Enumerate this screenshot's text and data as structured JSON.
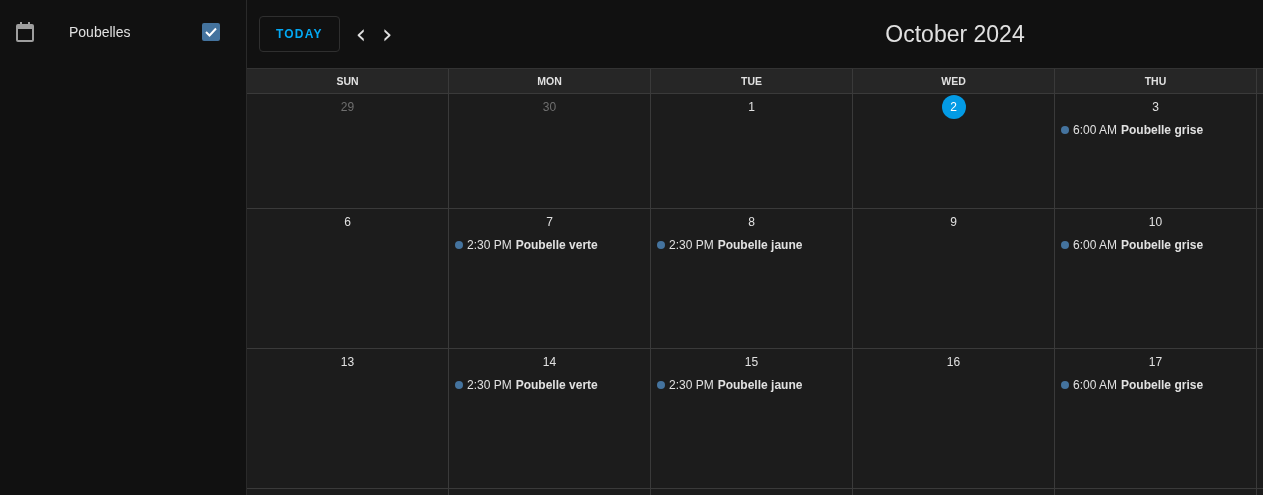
{
  "sidebar": {
    "calendars": [
      {
        "label": "Poubelles",
        "checked": true
      }
    ]
  },
  "toolbar": {
    "today_label": "TODAY",
    "prev": "‹",
    "next": "›",
    "title": "October 2024"
  },
  "weekdays": [
    "SUN",
    "MON",
    "TUE",
    "WED",
    "THU"
  ],
  "weeks": [
    {
      "days": [
        {
          "number": "29",
          "other_month": true,
          "today": false
        },
        {
          "number": "30",
          "other_month": true,
          "today": false
        },
        {
          "number": "1",
          "other_month": false,
          "today": false
        },
        {
          "number": "2",
          "other_month": false,
          "today": true
        },
        {
          "number": "3",
          "other_month": false,
          "today": false,
          "events": [
            {
              "time": "6:00 AM",
              "title": "Poubelle grise",
              "color": "#44739e"
            }
          ]
        }
      ]
    },
    {
      "days": [
        {
          "number": "6",
          "other_month": false,
          "today": false
        },
        {
          "number": "7",
          "other_month": false,
          "today": false,
          "events": [
            {
              "time": "2:30 PM",
              "title": "Poubelle verte",
              "color": "#44739e"
            }
          ]
        },
        {
          "number": "8",
          "other_month": false,
          "today": false,
          "events": [
            {
              "time": "2:30 PM",
              "title": "Poubelle jaune",
              "color": "#44739e"
            }
          ]
        },
        {
          "number": "9",
          "other_month": false,
          "today": false
        },
        {
          "number": "10",
          "other_month": false,
          "today": false,
          "events": [
            {
              "time": "6:00 AM",
              "title": "Poubelle grise",
              "color": "#44739e"
            }
          ]
        }
      ]
    },
    {
      "days": [
        {
          "number": "13",
          "other_month": false,
          "today": false
        },
        {
          "number": "14",
          "other_month": false,
          "today": false,
          "events": [
            {
              "time": "2:30 PM",
              "title": "Poubelle verte",
              "color": "#44739e"
            }
          ]
        },
        {
          "number": "15",
          "other_month": false,
          "today": false,
          "events": [
            {
              "time": "2:30 PM",
              "title": "Poubelle jaune",
              "color": "#44739e"
            }
          ]
        },
        {
          "number": "16",
          "other_month": false,
          "today": false
        },
        {
          "number": "17",
          "other_month": false,
          "today": false,
          "events": [
            {
              "time": "6:00 AM",
              "title": "Poubelle grise",
              "color": "#44739e"
            }
          ]
        }
      ]
    }
  ]
}
